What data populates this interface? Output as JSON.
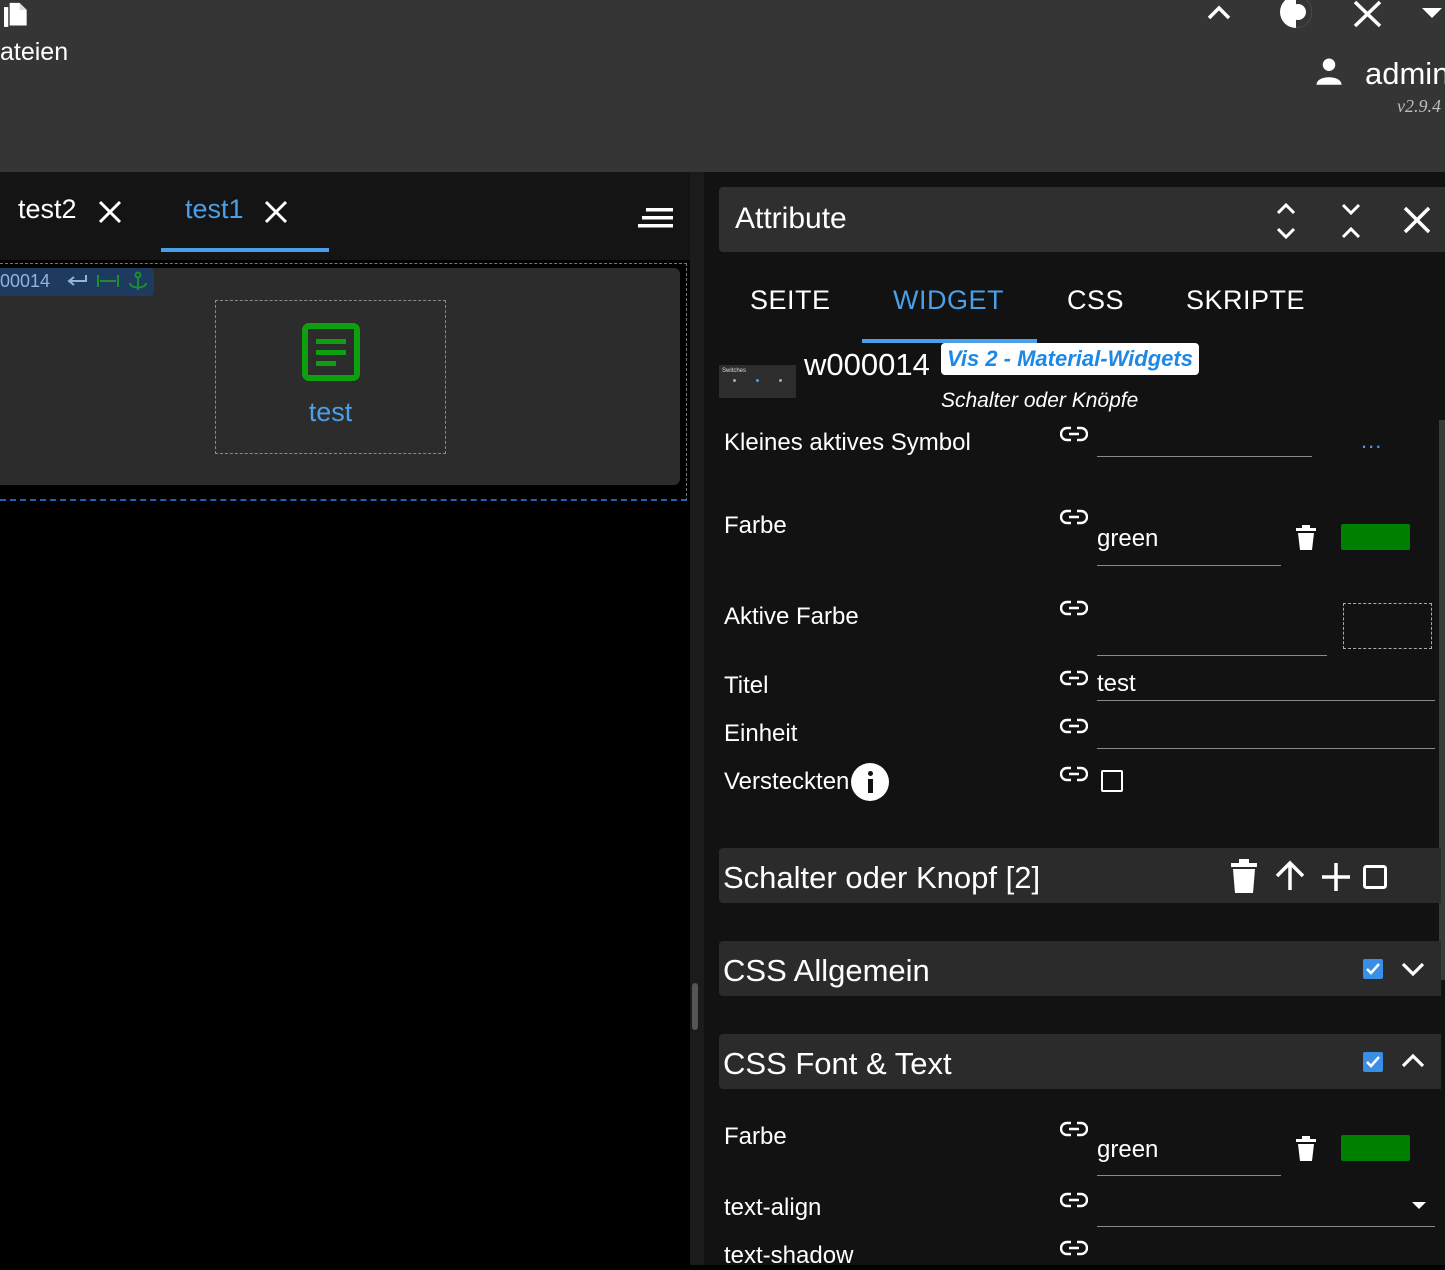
{
  "topbar": {
    "files_label": "ateien",
    "user_name": "admin",
    "version": "v2.9.4"
  },
  "editor": {
    "tabs": [
      {
        "label": "test2",
        "active": false
      },
      {
        "label": "test1",
        "active": true
      }
    ],
    "widget_id_badge": "00014",
    "widget_title": "test"
  },
  "panel": {
    "title": "Attribute",
    "tabs": [
      "SEITE",
      "WIDGET",
      "CSS",
      "SKRIPTE"
    ],
    "active_tab": "WIDGET",
    "widget": {
      "id": "w000014",
      "set_badge": "Vis 2 - Material-Widgets",
      "type": "Schalter oder Knöpfe",
      "thumb_title": "Switches"
    },
    "fields": {
      "small_active_icon": {
        "label": "Kleines aktives Symbol",
        "value": "",
        "more": "..."
      },
      "color": {
        "label": "Farbe",
        "value": "green",
        "swatch": "#008000"
      },
      "active_color": {
        "label": "Aktive Farbe",
        "value": ""
      },
      "title": {
        "label": "Titel",
        "value": "test"
      },
      "unit": {
        "label": "Einheit",
        "value": ""
      },
      "hide": {
        "label": "Versteckten",
        "checked": false
      }
    },
    "sections": {
      "switch_group": {
        "title": "Schalter oder Knopf [2]"
      },
      "css_common": {
        "title": "CSS Allgemein",
        "checked": true,
        "expanded": false
      },
      "css_font": {
        "title": "CSS Font & Text",
        "checked": true,
        "expanded": true
      }
    },
    "font_fields": {
      "color": {
        "label": "Farbe",
        "value": "green",
        "swatch": "#008000"
      },
      "text_align": {
        "label": "text-align",
        "value": ""
      },
      "text_shadow": {
        "label": "text-shadow",
        "value": ""
      }
    }
  },
  "colors": {
    "accent": "#4a9fe8",
    "green": "#008000",
    "header_bg": "#353535",
    "panel_bg": "#121212"
  }
}
